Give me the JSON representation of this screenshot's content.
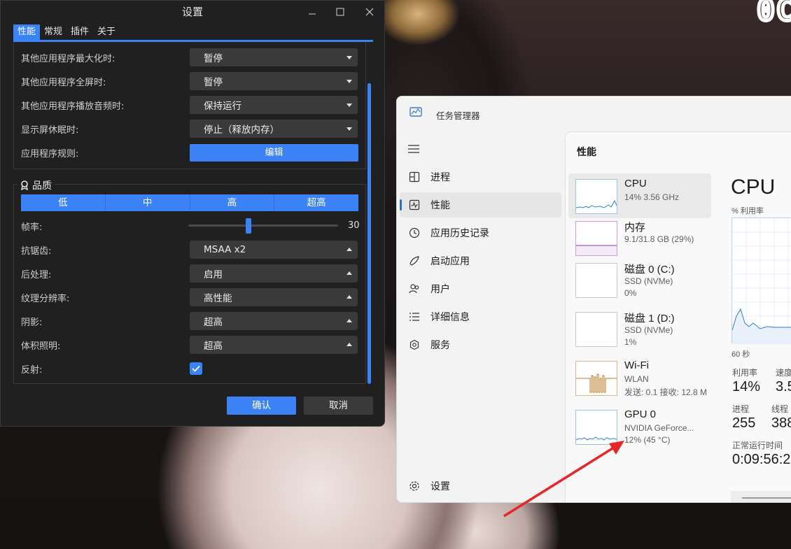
{
  "desktop": {
    "clock_text": "0C"
  },
  "settings": {
    "title": "设置",
    "controls": {
      "minimize": "—",
      "maximize": "☐",
      "close": "✕"
    },
    "tabs": [
      {
        "label": "性能",
        "active": true
      },
      {
        "label": "常规",
        "active": false
      },
      {
        "label": "插件",
        "active": false
      },
      {
        "label": "关于",
        "active": false
      }
    ],
    "rows_top": [
      {
        "label": "其他应用程序最大化时:",
        "value": "暂停"
      },
      {
        "label": "其他应用程序全屏时:",
        "value": "暂停"
      },
      {
        "label": "其他应用程序播放音频时:",
        "value": "保持运行"
      },
      {
        "label": "显示屏休眠时:",
        "value": "停止（释放内存）"
      }
    ],
    "app_rules": {
      "label": "应用程序规则:",
      "button": "编辑"
    },
    "quality": {
      "title": "品质",
      "presets": [
        "低",
        "中",
        "高",
        "超高"
      ],
      "framerate": {
        "label": "帧率:",
        "value": "30",
        "fraction": 0.4
      },
      "rows": [
        {
          "label": "抗锯齿:",
          "value": "MSAA x2"
        },
        {
          "label": "后处理:",
          "value": "启用"
        },
        {
          "label": "纹理分辨率:",
          "value": "高性能"
        },
        {
          "label": "阴影:",
          "value": "超高"
        },
        {
          "label": "体积照明:",
          "value": "超高"
        }
      ],
      "reflection": {
        "label": "反射:",
        "checked": true
      }
    },
    "buttons": {
      "ok": "确认",
      "cancel": "取消"
    },
    "accent": "#3b82f6"
  },
  "taskmgr": {
    "title": "任务管理器",
    "nav": [
      {
        "icon": "processes-icon",
        "label": "进程"
      },
      {
        "icon": "performance-icon",
        "label": "性能",
        "active": true
      },
      {
        "icon": "app-history-icon",
        "label": "应用历史记录"
      },
      {
        "icon": "startup-icon",
        "label": "启动应用"
      },
      {
        "icon": "users-icon",
        "label": "用户"
      },
      {
        "icon": "details-icon",
        "label": "详细信息"
      },
      {
        "icon": "services-icon",
        "label": "服务"
      }
    ],
    "settings_label": "设置",
    "header": "性能",
    "items": [
      {
        "name": "CPU",
        "sub1": "14% 3.56 GHz",
        "sub2": ""
      },
      {
        "name": "内存",
        "sub1": "9.1/31.8 GB (29%)",
        "sub2": ""
      },
      {
        "name": "磁盘 0 (C:)",
        "sub1": "SSD (NVMe)",
        "sub2": "0%"
      },
      {
        "name": "磁盘 1 (D:)",
        "sub1": "SSD (NVMe)",
        "sub2": "1%"
      },
      {
        "name": "Wi-Fi",
        "sub1": "WLAN",
        "sub2": "发送: 0.1 接收: 12.8 M"
      },
      {
        "name": "GPU 0",
        "sub1": "NVIDIA GeForce...",
        "sub2": "12% (45 °C)"
      }
    ],
    "detail": {
      "title": "CPU",
      "util_label": "% 利用率",
      "time_label": "60 秒",
      "utilization": {
        "label": "利用率",
        "value": "14%"
      },
      "speed": {
        "label": "速度",
        "value": "3.5"
      },
      "processes": {
        "label": "进程",
        "value": "255"
      },
      "threads": {
        "label": "线程",
        "value": "388"
      },
      "uptime": {
        "label": "正常运行时间",
        "value": "0:09:56:2"
      }
    },
    "accent": "#2f6fd6"
  },
  "annotation": {
    "arrow_color": "#e5262b"
  }
}
